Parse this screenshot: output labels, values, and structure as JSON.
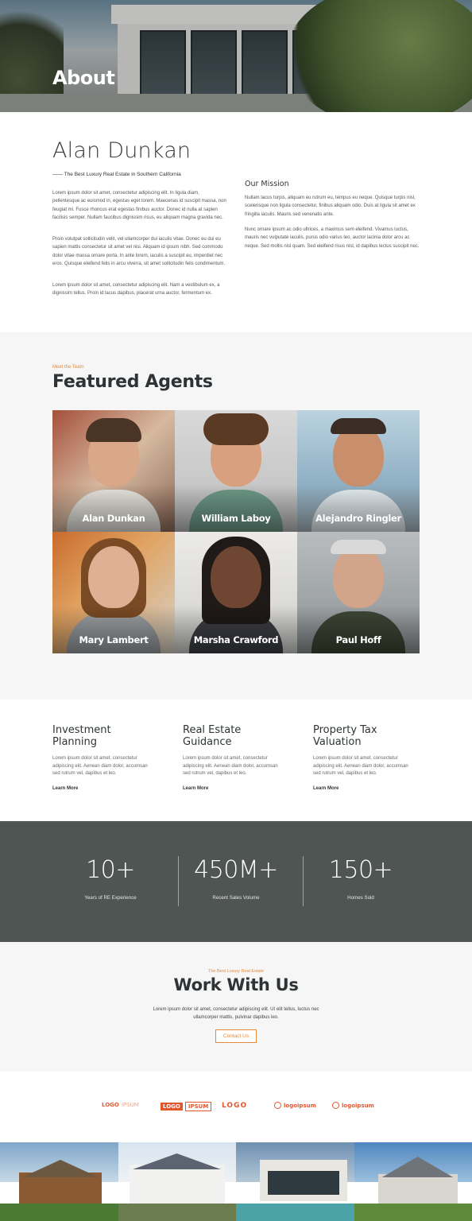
{
  "hero": {
    "title": "About"
  },
  "intro": {
    "name": "Alan Dunkan",
    "tagline": "—— The Best Luxury Real Estate in Southern California",
    "paragraphs": [
      "Lorem ipsum dolor sit amet, consectetur adipiscing elit. In ligula diam, pellentesque ac euismod in, egestas eget lorem. Maecenas id suscipit massa, non feugiat mi. Fusce rhoncus erat egestas finibus auctor. Donec id nulla at sapien facilisis semper. Nullam faucibus dignissim risus, eu aliquam magna gravida nec.",
      "Proin volutpat sollicitudin velit, vel ullamcorper dui iaculis vitae. Donec eu dui eu sapien mattis consectetur sit amet vel nisi. Aliquam id ipsum nibh. Sed commodo dolor vitae massa ornare porta. In ante lorem, iaculis a suscipit eu, imperdiet nec eros. Quisque eleifend felis in arcu viverra, sit amet sollicitudin felis condimentum.",
      "Lorem ipsum dolor sit amet, consectetur adipiscing elit. Nam a vestibulum ex, a dignissim tellus. Proin id lacus dapibus, placerat urna auctor, fermentum ex."
    ],
    "mission_title": "Our Mission",
    "mission_paragraphs": [
      "Nullam lacus turpis, aliquam eu rutrum eu, tempus eu neque. Quisque turpis nisl, scelerisque non ligula consectetur, finibus aliquam odio. Duis at ligula sit amet ex fringilla iaculis. Mauris sed venenatis ante.",
      "Nunc ornare ipsum ac odio ultrices, a maximus sem eleifend. Vivamus luctus, mauris nec vulputate iaculis, purus odio varius leo, auctor lacinia dolor arcu ac neque. Sed mollis nisl quam. Sed eleifend risus nisl, id dapibus lectus suscipit nec."
    ]
  },
  "agents": {
    "eyebrow": "Meet the Team",
    "title": "Featured Agents",
    "items": [
      {
        "name": "Alan Dunkan"
      },
      {
        "name": "William Laboy"
      },
      {
        "name": "Alejandro Ringler"
      },
      {
        "name": "Mary Lambert"
      },
      {
        "name": "Marsha Crawford"
      },
      {
        "name": "Paul Hoff"
      }
    ]
  },
  "services": [
    {
      "title": "Investment Planning",
      "description": "Lorem ipsum dolor sit amet, consectetur adipiscing elit. Aenean diam dolor, accumsan sed rutrum vel, dapibus et leo.",
      "link": "Learn More"
    },
    {
      "title": "Real Estate Guidance",
      "description": "Lorem ipsum dolor sit amet, consectetur adipiscing elit. Aenean diam dolor, accumsan sed rutrum vel, dapibus et leo.",
      "link": "Learn More"
    },
    {
      "title": "Property Tax Valuation",
      "description": "Lorem ipsum dolor sit amet, consectetur adipiscing elit. Aenean diam dolor, accumsan sed rutrum vel, dapibus et leo.",
      "link": "Learn More"
    }
  ],
  "stats": [
    {
      "value": "10+",
      "label": "Years of RE Experience"
    },
    {
      "value": "450M+",
      "label": "Recent Sales Volume"
    },
    {
      "value": "150+",
      "label": "Homes Sold"
    }
  ],
  "work": {
    "eyebrow": "The Best Luxury Real Estate",
    "title": "Work With Us",
    "description": "Lorem ipsum dolor sit amet, consectetur adipiscing elit. Ut elit tellus, luctus nec ullamcorper mattis, pulvinar dapibus leo.",
    "button": "Contact Us"
  },
  "logos": {
    "l1a": "LOGO",
    "l1b": "IPSUM",
    "l2a": "LOGO",
    "l2b": "IPSUM",
    "l3": "LOGO",
    "l4": "logoipsum",
    "l5": "logoipsum"
  },
  "colors": {
    "accent": "#e38a3d",
    "logo": "#e4572e",
    "stats_bg": "#4f5552",
    "section_bg": "#f6f6f6",
    "heading": "#2e3436"
  }
}
